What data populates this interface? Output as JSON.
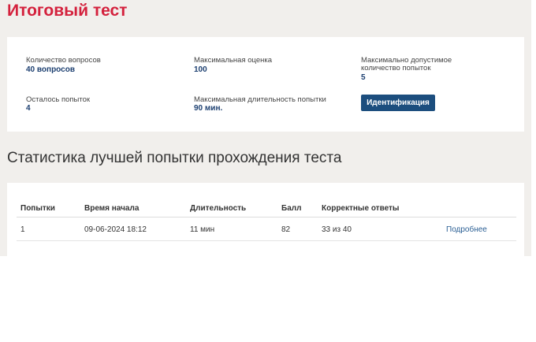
{
  "page": {
    "title": "Итоговый тест",
    "accent_color": "#d4213d",
    "value_color": "#1c3f70",
    "button_color": "#1c4e7e"
  },
  "test_info": {
    "questions_label": "Количество вопросов",
    "questions_value": "40 вопросов",
    "max_score_label": "Максимальная оценка",
    "max_score_value": "100",
    "max_attempts_label": "Максимально допустимое количество попыток",
    "max_attempts_value": "5",
    "remaining_label": "Осталось попыток",
    "remaining_value": "4",
    "max_duration_label": "Максимальная длительность попытки",
    "max_duration_value": "90 мин.",
    "identify_button": "Идентификация"
  },
  "stats": {
    "title": "Статистика лучшей попытки прохождения теста",
    "columns": [
      "Попытки",
      "Время начала",
      "Длительность",
      "Балл",
      "Корректные ответы"
    ],
    "rows": [
      {
        "attempt": "1",
        "start": "09-06-2024 18:12",
        "duration": "11 мин",
        "score": "82",
        "correct": "33 из 40",
        "details": "Подробнее"
      }
    ]
  }
}
